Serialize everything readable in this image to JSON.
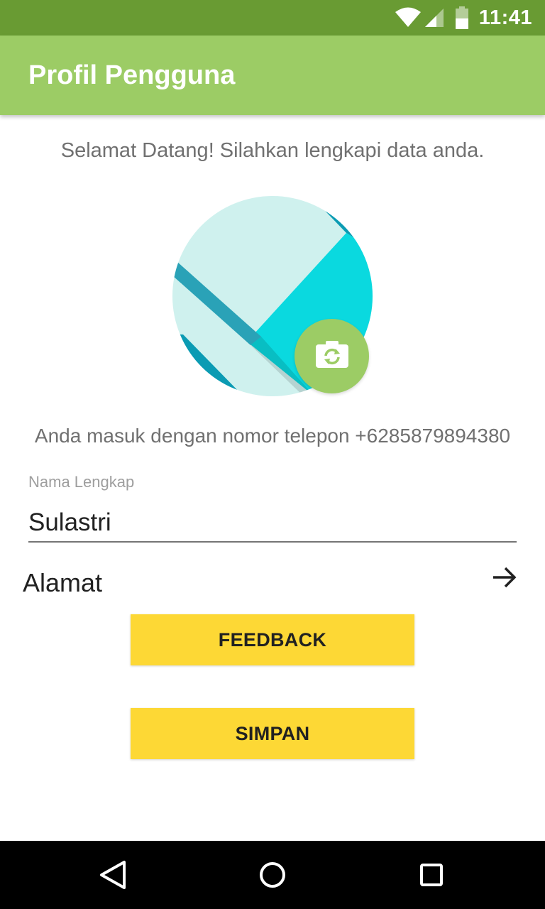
{
  "status_bar": {
    "time": "11:41",
    "icons": [
      "wifi-icon",
      "cell-signal-icon",
      "battery-icon"
    ],
    "background": "#699B33"
  },
  "app_bar": {
    "title": "Profil Pengguna",
    "background": "#9CCC65"
  },
  "main": {
    "welcome_text": "Selamat Datang! Silahkan lengkapi data anda.",
    "avatar": {
      "camera_icon": "camera-switch-icon"
    },
    "phone_info": "Anda masuk dengan nomor telepon +6285879894380",
    "name_field": {
      "label": "Nama Lengkap",
      "value": "Sulastri"
    },
    "address": {
      "label": "Alamat",
      "icon": "arrow-right-icon"
    },
    "feedback_label": "FEEDBACK",
    "save_label": "SIMPAN",
    "button_color": "#FDD835"
  },
  "nav_bar": {
    "icons": [
      "back-icon",
      "home-icon",
      "recents-icon"
    ]
  }
}
